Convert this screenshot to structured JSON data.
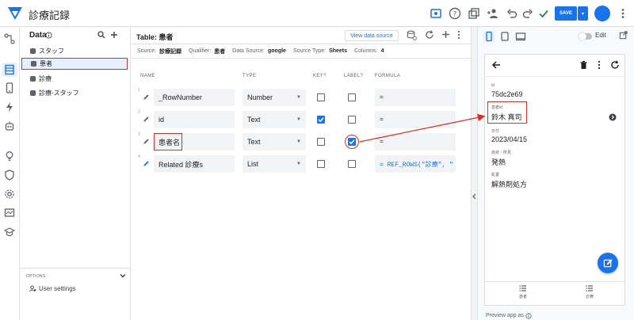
{
  "app": {
    "title": "診療記録"
  },
  "toolbar": {
    "save_label": "SAVE"
  },
  "data_panel": {
    "title": "Data",
    "items": [
      {
        "label": "スタッフ"
      },
      {
        "label": "患者"
      },
      {
        "label": "診療"
      },
      {
        "label": "診療-スタッフ"
      }
    ],
    "options_label": "OPTIONS",
    "user_settings": "User settings"
  },
  "table": {
    "title": "Table: 患者",
    "view_source_label": "View data source",
    "meta": {
      "source_label": "Source:",
      "source": "診療記録",
      "qualifier_label": "Qualifier:",
      "qualifier": "患者",
      "datasource_label": "Data Source:",
      "datasource": "google",
      "sourcetype_label": "Source Type:",
      "sourcetype": "Sheets",
      "columns_label": "Columns:",
      "columns": "4"
    },
    "headers": {
      "name": "NAME",
      "type": "TYPE",
      "key": "KEY?",
      "label": "LABEL?",
      "formula": "FORMULA"
    },
    "rows": [
      {
        "num": "1",
        "name": "_RowNumber",
        "type": "Number",
        "key": false,
        "label": false,
        "formula": "="
      },
      {
        "num": "2",
        "name": "id",
        "type": "Text",
        "key": true,
        "label": false,
        "formula": "="
      },
      {
        "num": "3",
        "name": "患者名",
        "type": "Text",
        "key": false,
        "label": true,
        "formula": "="
      },
      {
        "num": "4",
        "name": "Related 診療s",
        "type": "List",
        "key": false,
        "label": false,
        "formula": "= REF_ROWS(\"診療\", \""
      }
    ]
  },
  "preview": {
    "edit_label": "Edit",
    "fields": [
      {
        "label": "id",
        "value": "75dc2e69"
      },
      {
        "label": "患者id",
        "value": "鈴木 真司"
      },
      {
        "label": "日付",
        "value": "2023/04/15"
      },
      {
        "label": "症状・所見",
        "value": "発熱"
      },
      {
        "label": "処置",
        "value": "解熱剤処方"
      }
    ],
    "nav": [
      {
        "label": "患者"
      },
      {
        "label": "診療"
      }
    ],
    "preview_as": "Preview app as"
  },
  "colors": {
    "accent": "#1a73e8",
    "highlight": "#d93025"
  }
}
